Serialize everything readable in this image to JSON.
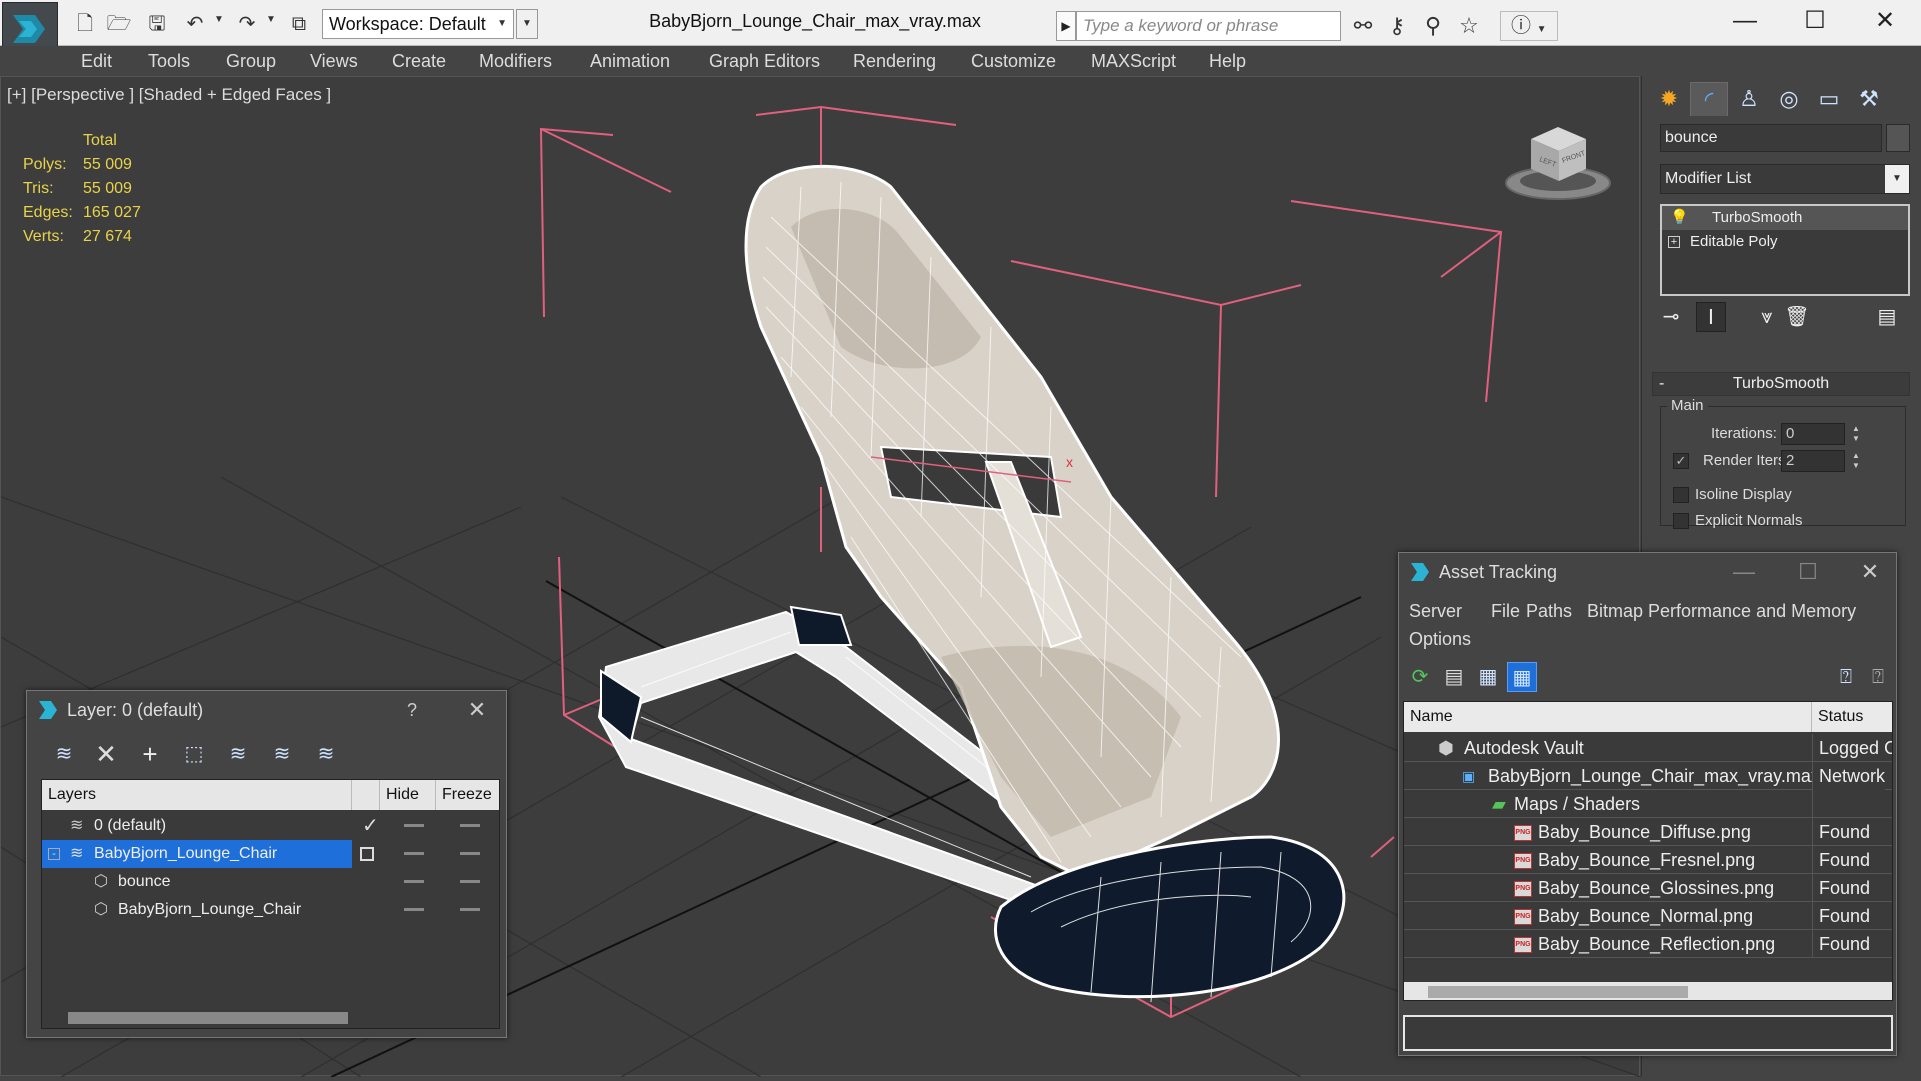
{
  "titlebar": {
    "workspace": "Workspace: Default",
    "document_title": "BabyBjorn_Lounge_Chair_max_vray.max",
    "search_placeholder": "Type a keyword or phrase"
  },
  "menu": [
    "Edit",
    "Tools",
    "Group",
    "Views",
    "Create",
    "Modifiers",
    "Animation",
    "Graph Editors",
    "Rendering",
    "Customize",
    "MAXScript",
    "Help"
  ],
  "viewport": {
    "label": "[+] [Perspective ] [Shaded + Edged Faces ]",
    "stats": {
      "header": "Total",
      "rows": [
        {
          "label": "Polys:",
          "value": "55 009"
        },
        {
          "label": "Tris:",
          "value": "55 009"
        },
        {
          "label": "Edges:",
          "value": "165 027"
        },
        {
          "label": "Verts:",
          "value": "27 674"
        }
      ]
    },
    "viewcube": {
      "left": "LEFT",
      "front": "FRONT"
    }
  },
  "command_panel": {
    "object_name": "bounce",
    "modifier_list": "Modifier List",
    "stack": [
      "TurboSmooth",
      "Editable Poly"
    ],
    "rollout_title": "TurboSmooth",
    "group_main": "Main",
    "iterations_label": "Iterations:",
    "iterations_value": "0",
    "render_iters_label": "Render Iters:",
    "render_iters_value": "2",
    "isoline_label": "Isoline Display",
    "explicit_normals_label": "Explicit Normals"
  },
  "layer_dialog": {
    "title": "Layer: 0 (default)",
    "help": "?",
    "columns": [
      "Layers",
      "Hide",
      "Freeze"
    ],
    "rows": [
      {
        "name": "0 (default)"
      },
      {
        "name": "BabyBjorn_Lounge_Chair"
      },
      {
        "name": "bounce"
      },
      {
        "name": "BabyBjorn_Lounge_Chair"
      }
    ]
  },
  "asset_tracking": {
    "title": "Asset Tracking",
    "menus": [
      "Server",
      "File",
      "Paths",
      "Bitmap Performance and Memory",
      "Options"
    ],
    "columns": [
      "Name",
      "Status"
    ],
    "rows": [
      {
        "name": "Autodesk Vault",
        "status": "Logged O"
      },
      {
        "name": "BabyBjorn_Lounge_Chair_max_vray.max",
        "status": "Network"
      },
      {
        "name": "Maps / Shaders",
        "status": ""
      },
      {
        "name": "Baby_Bounce_Diffuse.png",
        "status": "Found"
      },
      {
        "name": "Baby_Bounce_Fresnel.png",
        "status": "Found"
      },
      {
        "name": "Baby_Bounce_Glossines.png",
        "status": "Found"
      },
      {
        "name": "Baby_Bounce_Normal.png",
        "status": "Found"
      },
      {
        "name": "Baby_Bounce_Reflection.png",
        "status": "Found"
      }
    ],
    "badge": "PNG"
  },
  "colors": {
    "stats": "#e8d34a",
    "selection": "#1e6fd9",
    "bbox": "#e0607e",
    "accent": "#2c7c9c"
  }
}
